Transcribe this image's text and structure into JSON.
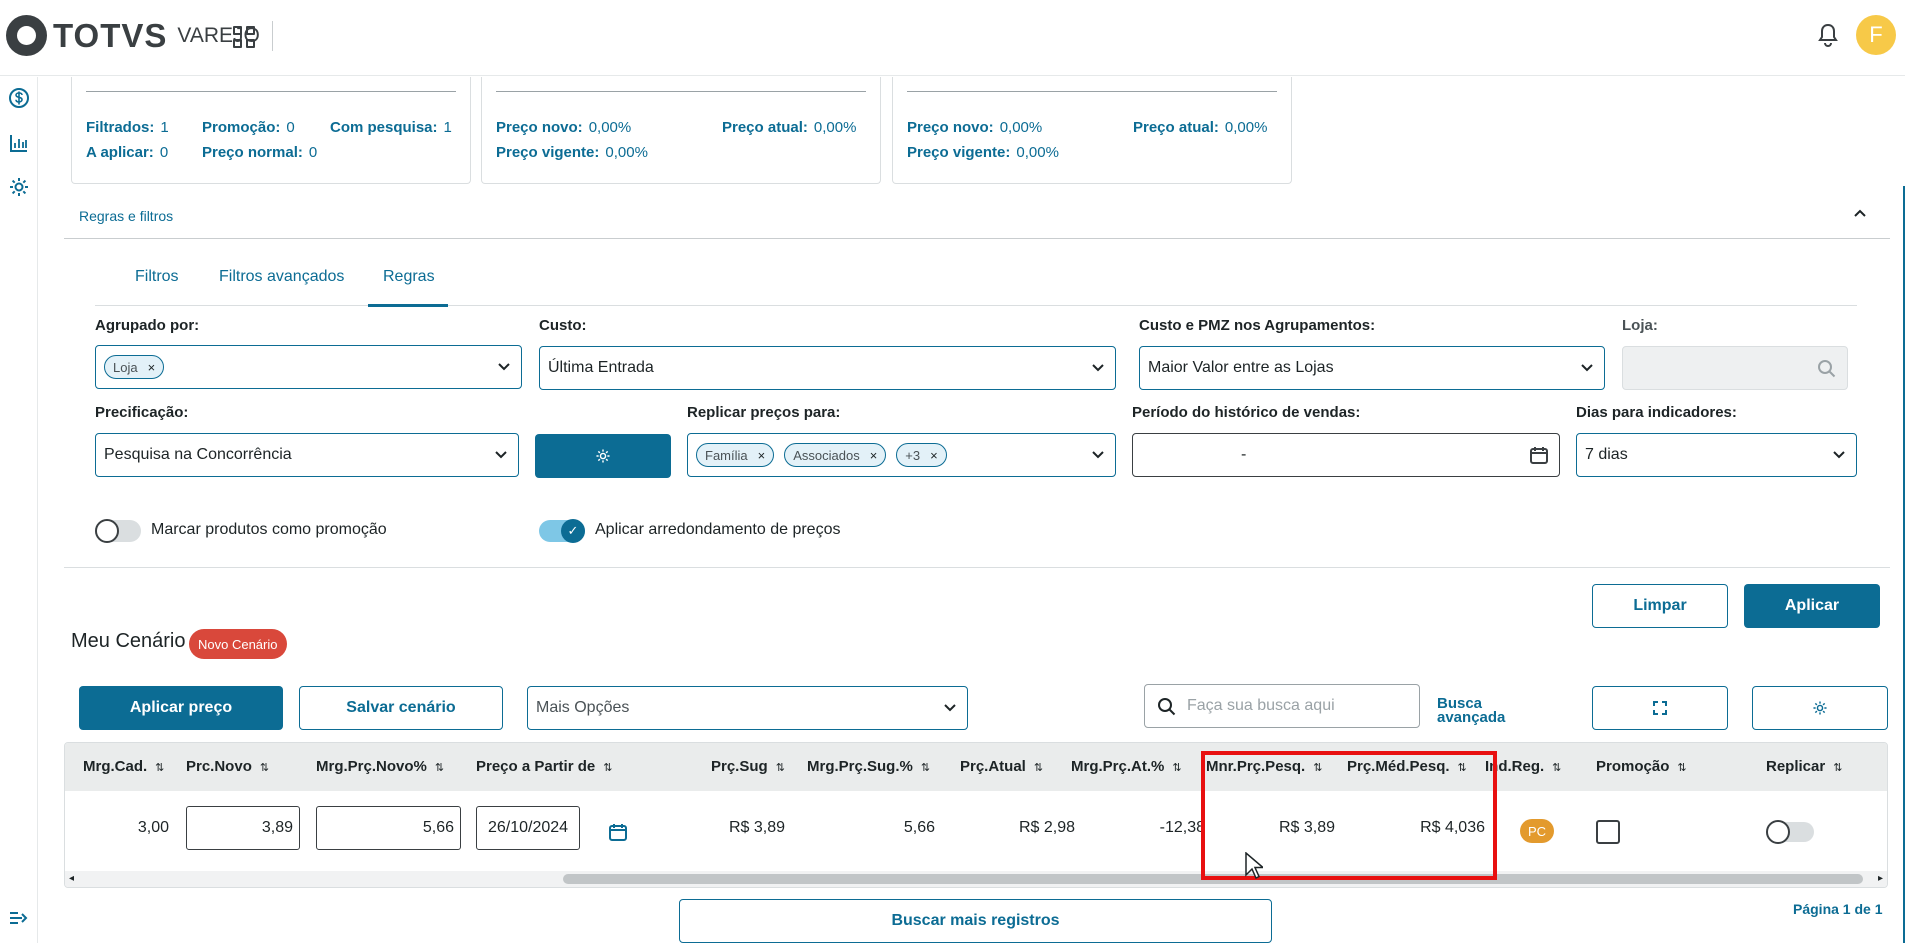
{
  "header": {
    "brand": "TOTVS",
    "product": "VAREJO",
    "avatar_initial": "F"
  },
  "sidebar": {
    "items": [
      {
        "icon": "dollar-circle-icon"
      },
      {
        "icon": "bar-chart-icon"
      },
      {
        "icon": "gear-icon"
      }
    ]
  },
  "summary_cards": [
    {
      "rows": [
        [
          {
            "label": "Filtrados:",
            "value": "1"
          },
          {
            "label": "Promoção:",
            "value": "0"
          },
          {
            "label": "Com pesquisa:",
            "value": "1"
          }
        ],
        [
          {
            "label": "A aplicar:",
            "value": "0"
          },
          {
            "label": "Preço normal:",
            "value": "0"
          }
        ]
      ]
    },
    {
      "rows": [
        [
          {
            "label": "Preço novo:",
            "value": "0,00%"
          },
          {
            "label": "Preço atual:",
            "value": "0,00%"
          }
        ],
        [
          {
            "label": "Preço vigente:",
            "value": "0,00%"
          }
        ]
      ]
    },
    {
      "rows": [
        [
          {
            "label": "Preço novo:",
            "value": "0,00%"
          },
          {
            "label": "Preço atual:",
            "value": "0,00%"
          }
        ],
        [
          {
            "label": "Preço vigente:",
            "value": "0,00%"
          }
        ]
      ]
    }
  ],
  "rules_section": {
    "title": "Regras e filtros",
    "tabs": [
      "Filtros",
      "Filtros avançados",
      "Regras"
    ],
    "active_tab": "Regras",
    "fields": {
      "agrupado_label": "Agrupado por:",
      "agrupado_tag": "Loja",
      "custo_label": "Custo:",
      "custo_value": "Última Entrada",
      "custo_pmz_label": "Custo e PMZ nos Agrupamentos:",
      "custo_pmz_value": "Maior Valor entre as Lojas",
      "loja_label": "Loja:",
      "precificacao_label": "Precificação:",
      "precificacao_value": "Pesquisa na Concorrência",
      "replicar_label": "Replicar preços para:",
      "replicar_tags": [
        "Família",
        "Associados",
        "+3"
      ],
      "periodo_label": "Período do histórico de vendas:",
      "periodo_value": "-",
      "dias_label": "Dias para indicadores:",
      "dias_value": "7 dias"
    },
    "toggles": {
      "promo_label": "Marcar produtos como promoção",
      "promo_on": false,
      "arredondamento_label": "Aplicar arredondamento de preços",
      "arredondamento_on": true
    },
    "buttons": {
      "clear": "Limpar",
      "apply": "Aplicar"
    }
  },
  "scenario": {
    "title": "Meu Cenário",
    "badge": "Novo Cenário",
    "apply_price": "Aplicar preço",
    "save_scenario": "Salvar cenário",
    "more_options": "Mais Opções",
    "search_placeholder": "Faça sua busca aqui",
    "advanced_search_line1": "Busca",
    "advanced_search_line2": "avançada"
  },
  "table": {
    "columns": [
      "Mrg.Cad.",
      "Prc.Novo",
      "Mrg.Prç.Novo%",
      "Preço a Partir de",
      "Prç.Sug",
      "Mrg.Prç.Sug.%",
      "Prç.Atual",
      "Mrg.Prç.At.%",
      "Mnr.Prç.Pesq.",
      "Prç.Méd.Pesq.",
      "Ind.Reg.",
      "Promoção",
      "Replicar"
    ],
    "row": {
      "mrg_cad": "3,00",
      "prc_novo": "3,89",
      "mrg_prc_novo": "5,66",
      "preco_a_partir": "26/10/2024",
      "prc_sug": "R$ 3,89",
      "mrg_prc_sug": "5,66",
      "prc_atual": "R$ 2,98",
      "mrg_prc_at": "-12,38",
      "mnr_prc_pesq": "R$ 3,89",
      "prc_med_pesq": "R$ 4,036",
      "ind_reg": "PC",
      "promocao": false,
      "replicar": false
    }
  },
  "footer": {
    "more_records": "Buscar mais registros",
    "page_info": "Página 1 de 1"
  },
  "colors": {
    "primary": "#0c6c94",
    "danger": "#d9483b",
    "warning": "#e39a2d",
    "highlight": "#e81010"
  }
}
